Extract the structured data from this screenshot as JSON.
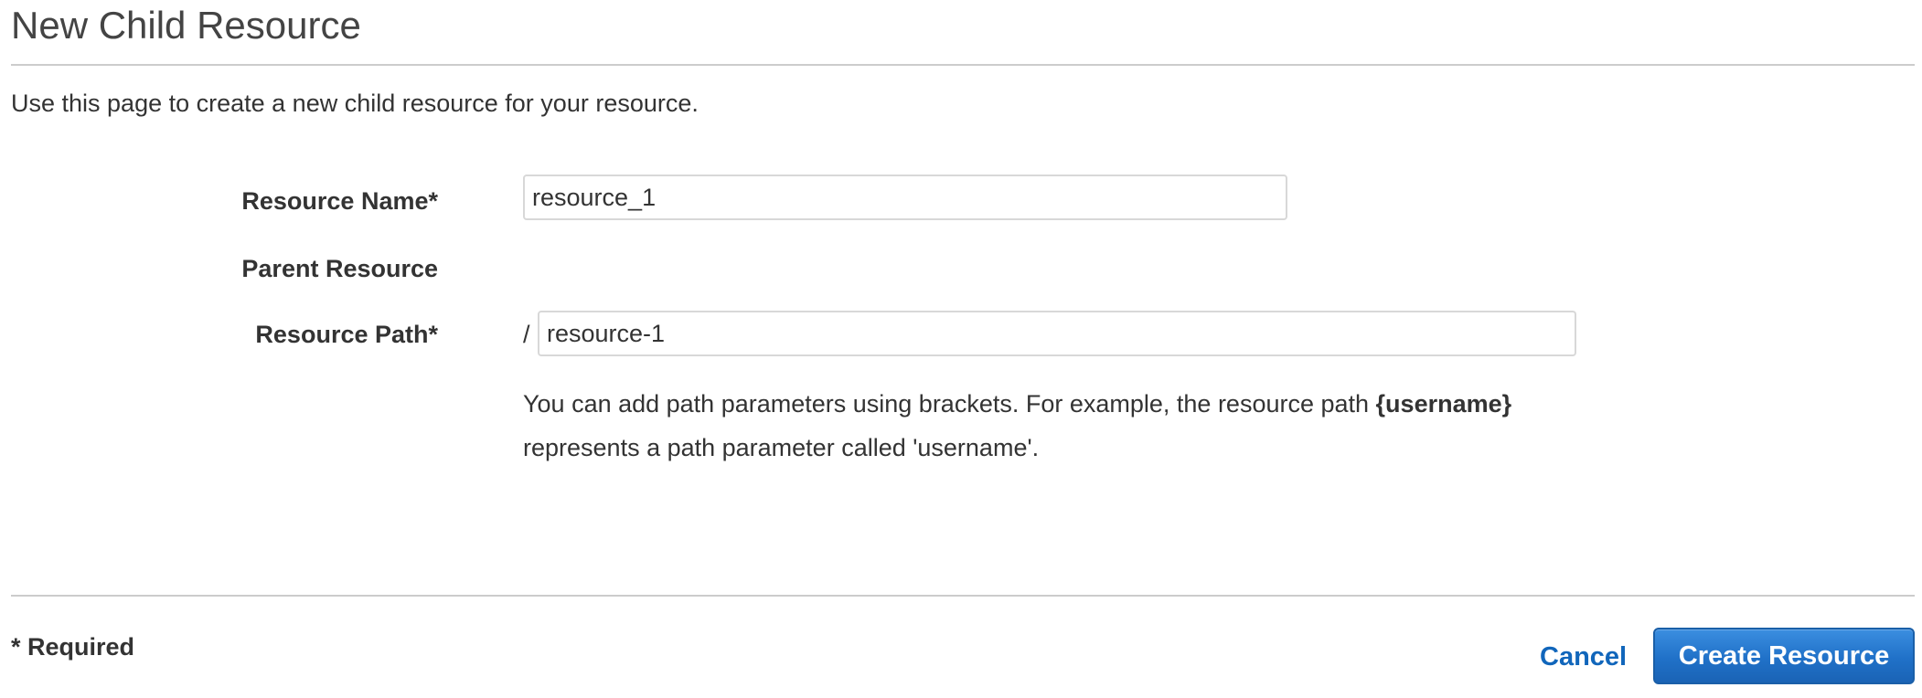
{
  "header": {
    "title": "New Child Resource"
  },
  "description": "Use this page to create a new child resource for your resource.",
  "form": {
    "resource_name": {
      "label": "Resource Name*",
      "value": "resource_1"
    },
    "parent_resource": {
      "label": "Parent Resource"
    },
    "resource_path": {
      "label": "Resource Path*",
      "prefix": "/",
      "value": "resource-1"
    },
    "help": {
      "text_before": "You can add path parameters using brackets. For example, the resource path ",
      "example": "{username}",
      "text_after": " represents a path parameter called 'username'."
    }
  },
  "footer": {
    "required_note": "* Required",
    "cancel_label": "Cancel",
    "create_label": "Create Resource"
  },
  "colors": {
    "link": "#1166bb",
    "primary_button": "#2071c8",
    "divider": "#cccccc",
    "text": "#333333"
  }
}
